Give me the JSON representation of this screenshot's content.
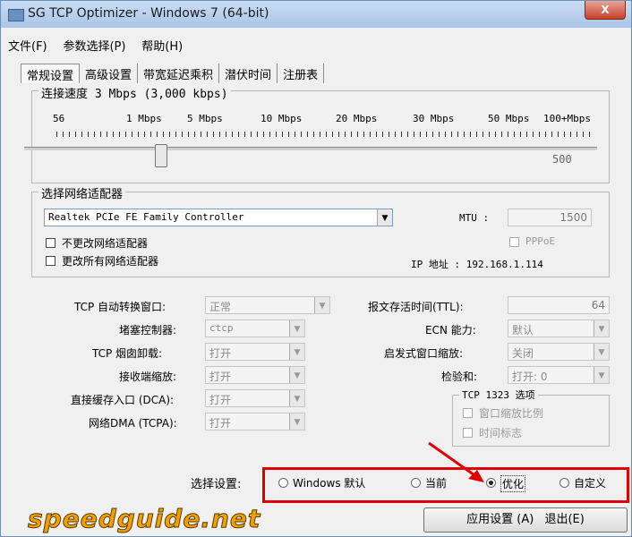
{
  "window": {
    "title": "SG TCP Optimizer - Windows 7 (64-bit)",
    "close": "X"
  },
  "menu": [
    "文件(F)",
    "参数选择(P)",
    "帮助(H)"
  ],
  "tabs": [
    "常规设置",
    "高级设置",
    "带宽延迟乘积",
    "潜伏时间",
    "注册表"
  ],
  "speed": {
    "legend": "连接速度  3 Mbps (3,000 kbps)",
    "ticks": [
      "56",
      "1 Mbps",
      "5 Mbps",
      "10 Mbps",
      "20 Mbps",
      "30 Mbps",
      "50 Mbps",
      "100+Mbps"
    ],
    "scale_value": "500"
  },
  "adapter": {
    "legend": "选择网络适配器",
    "selected": "Realtek PCIe FE Family Controller",
    "mtu_label": "MTU :",
    "mtu_value": "1500",
    "pppoe": "PPPoE",
    "no_change": "不更改网络适配器",
    "change_all": "更改所有网络适配器",
    "ip": "IP 地址 : 192.168.1.114"
  },
  "settings_left": [
    {
      "label": "TCP 自动转换窗口:",
      "value": "正常"
    },
    {
      "label": "堵塞控制器:",
      "value": "ctcp"
    },
    {
      "label": "TCP 烟囱卸载:",
      "value": "打开"
    },
    {
      "label": "接收端缩放:",
      "value": "打开"
    },
    {
      "label": "直接缓存入口 (DCA):",
      "value": "打开"
    },
    {
      "label": "网络DMA (TCPA):",
      "value": "打开"
    }
  ],
  "settings_right": [
    {
      "label": "报文存活时间(TTL):",
      "value": "64"
    },
    {
      "label": "ECN 能力:",
      "value": "默认"
    },
    {
      "label": "启发式窗口缩放:",
      "value": "关闭"
    },
    {
      "label": "检验和:",
      "value": "打开: 0"
    }
  ],
  "tcp1323": {
    "legend": "TCP 1323 选项",
    "opt1": "窗口缩放比例",
    "opt2": "时间标志"
  },
  "choose": {
    "label": "选择设置:",
    "options": [
      "Windows 默认",
      "当前",
      "优化",
      "自定义"
    ],
    "selected": "优化"
  },
  "apply_button": "应用设置 (A)",
  "exit_button": "退出(E)",
  "logo": "speedguide.net"
}
